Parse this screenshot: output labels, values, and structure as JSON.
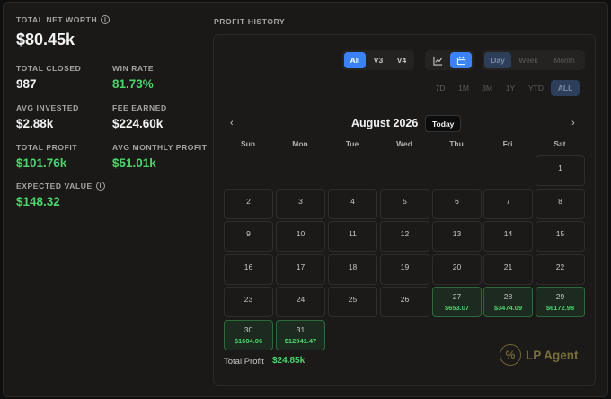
{
  "stats": {
    "net_worth_label": "TOTAL NET WORTH",
    "net_worth": "$80.45k",
    "total_closed_label": "TOTAL CLOSED",
    "total_closed": "987",
    "win_rate_label": "WIN RATE",
    "win_rate": "81.73%",
    "avg_invested_label": "AVG INVESTED",
    "avg_invested": "$2.88k",
    "fee_earned_label": "FEE EARNED",
    "fee_earned": "$224.60k",
    "total_profit_label": "TOTAL PROFIT",
    "total_profit": "$101.76k",
    "avg_monthly_label": "AVG MONTHLY PROFIT",
    "avg_monthly": "$51.01k",
    "expected_value_label": "EXPECTED VALUE",
    "expected_value": "$148.32"
  },
  "history": {
    "title": "PROFIT HISTORY",
    "version_filters": [
      "All",
      "V3",
      "V4"
    ],
    "version_selected": "All",
    "view_icons": [
      "chart-line-icon",
      "calendar-icon"
    ],
    "view_selected": "calendar-icon",
    "granularity": [
      "Day",
      "Week",
      "Month"
    ],
    "granularity_selected": "Day",
    "ranges": [
      "7D",
      "1M",
      "3M",
      "1Y",
      "YTD",
      "ALL"
    ],
    "range_selected": "ALL",
    "month_label": "August 2026",
    "today_label": "Today",
    "prev_glyph": "‹",
    "next_glyph": "›",
    "weekdays": [
      "Sun",
      "Mon",
      "Tue",
      "Wed",
      "Thu",
      "Fri",
      "Sat"
    ],
    "days": [
      {
        "day": "1"
      },
      {
        "day": "2"
      },
      {
        "day": "3"
      },
      {
        "day": "4"
      },
      {
        "day": "5"
      },
      {
        "day": "6"
      },
      {
        "day": "7"
      },
      {
        "day": "8"
      },
      {
        "day": "9"
      },
      {
        "day": "10"
      },
      {
        "day": "11"
      },
      {
        "day": "12"
      },
      {
        "day": "13"
      },
      {
        "day": "14"
      },
      {
        "day": "15"
      },
      {
        "day": "16"
      },
      {
        "day": "17"
      },
      {
        "day": "18"
      },
      {
        "day": "19"
      },
      {
        "day": "20"
      },
      {
        "day": "21"
      },
      {
        "day": "22"
      },
      {
        "day": "23"
      },
      {
        "day": "24"
      },
      {
        "day": "25"
      },
      {
        "day": "26"
      },
      {
        "day": "27",
        "profit": "$653.07"
      },
      {
        "day": "28",
        "profit": "$3474.09"
      },
      {
        "day": "29",
        "profit": "$6172.98"
      },
      {
        "day": "30",
        "profit": "$1604.06"
      },
      {
        "day": "31",
        "profit": "$12941.47"
      }
    ],
    "total_label": "Total Profit",
    "total_value": "$24.85k",
    "brand": "LP Agent",
    "brand_icon": "percent-icon"
  },
  "colors": {
    "accent": "#3b82f6",
    "profit_green": "#4ad66d",
    "background": "#1a1918"
  }
}
